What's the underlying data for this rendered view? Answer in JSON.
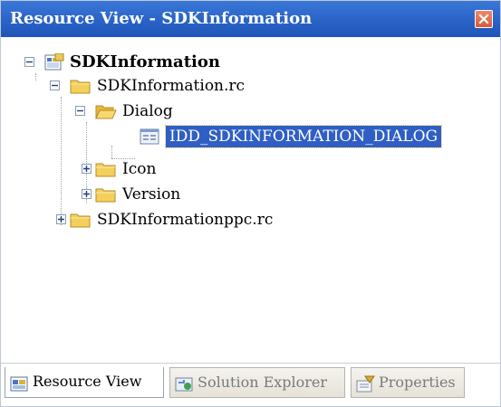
{
  "window": {
    "title": "Resource View - SDKInformation",
    "close_icon": "close-icon"
  },
  "tree": {
    "root": {
      "label": "SDKInformation",
      "icon": "project-icon",
      "expanded": true
    },
    "rc_file": {
      "label": "SDKInformation.rc",
      "icon": "folder-icon",
      "expanded": true
    },
    "dialog_folder": {
      "label": "Dialog",
      "icon": "folder-icon",
      "expanded": true
    },
    "dialog_item": {
      "label": "IDD_SDKINFORMATION_DIALOG",
      "icon": "dialog-resource-icon",
      "selected": true
    },
    "icon_folder": {
      "label": "Icon",
      "icon": "folder-icon",
      "expanded": false
    },
    "version_folder": {
      "label": "Version",
      "icon": "folder-icon",
      "expanded": false
    },
    "ppc_file": {
      "label": "SDKInformationppc.rc",
      "icon": "folder-icon",
      "expanded": false
    }
  },
  "tabs": [
    {
      "label": "Resource View",
      "icon": "resource-view-icon",
      "active": true
    },
    {
      "label": "Solution Explorer",
      "icon": "solution-explorer-icon",
      "active": false
    },
    {
      "label": "Properties",
      "icon": "properties-icon",
      "active": false
    }
  ],
  "colors": {
    "titlebar": "#2a63c6",
    "selection": "#2f5fc4",
    "folder": "#f2c94c"
  }
}
